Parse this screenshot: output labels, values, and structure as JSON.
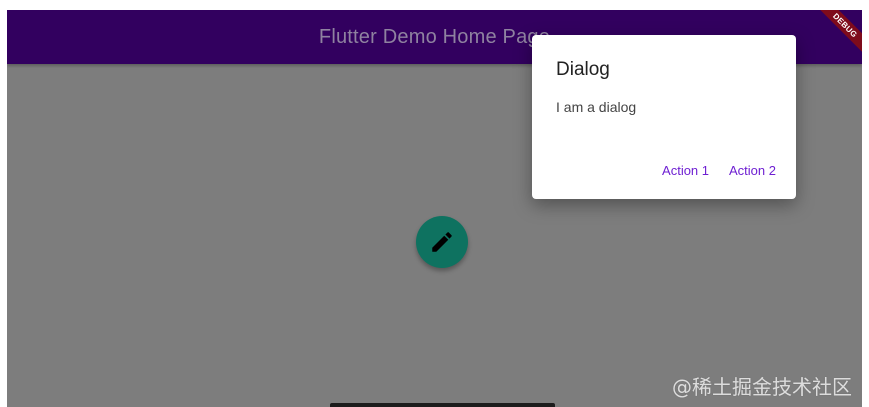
{
  "app_bar": {
    "title": "Flutter Demo Home Page"
  },
  "debug_banner": {
    "label": "DEBUG"
  },
  "dialog": {
    "title": "Dialog",
    "content": "I am a dialog",
    "actions": [
      {
        "label": "Action 1"
      },
      {
        "label": "Action 2"
      }
    ]
  },
  "fab": {
    "icon": "pencil-icon"
  },
  "watermark": {
    "text": "@稀土掘金技术社区"
  },
  "colors": {
    "app_bar": "#32005f",
    "scrim_background": "#7d7d7d",
    "fab": "#0e7260",
    "dialog_action": "#6e1fd2",
    "debug_banner": "#7e0b1c"
  }
}
